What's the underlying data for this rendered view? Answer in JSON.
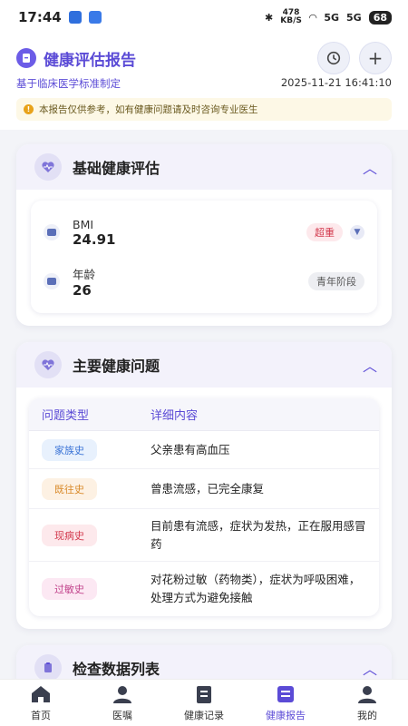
{
  "status_bar": {
    "time": "17:44",
    "speed_value": "478",
    "speed_unit": "KB/S",
    "sig1": "5G",
    "sig2": "5G",
    "battery": "68"
  },
  "header": {
    "title": "健康评估报告",
    "subtitle": "基于临床医学标准制定",
    "timestamp": "2025-11-21 16:41:10",
    "notice": "本报告仅供参考，如有健康问题请及时咨询专业医生",
    "add_label": "+"
  },
  "basic": {
    "title": "基础健康评估",
    "bmi": {
      "label": "BMI",
      "value": "24.91",
      "badge": "超重"
    },
    "age": {
      "label": "年龄",
      "value": "26",
      "badge": "青年阶段"
    }
  },
  "issues": {
    "title": "主要健康问题",
    "col_type": "问题类型",
    "col_detail": "详细内容",
    "rows": [
      {
        "type": "家族史",
        "detail": "父亲患有高血压"
      },
      {
        "type": "既往史",
        "detail": "曾患流感，已完全康复"
      },
      {
        "type": "现病史",
        "detail": "目前患有流感，症状为发热，正在服用感冒药"
      },
      {
        "type": "过敏史",
        "detail": "对花粉过敏（药物类），症状为呼吸困难，处理方式为避免接触"
      }
    ]
  },
  "exam": {
    "title": "检查数据列表"
  },
  "nav": [
    {
      "label": "首页"
    },
    {
      "label": "医嘱"
    },
    {
      "label": "健康记录"
    },
    {
      "label": "健康报告"
    },
    {
      "label": "我的"
    }
  ],
  "colors": {
    "accent": "#5b4bd6",
    "danger": "#d33a4e"
  }
}
